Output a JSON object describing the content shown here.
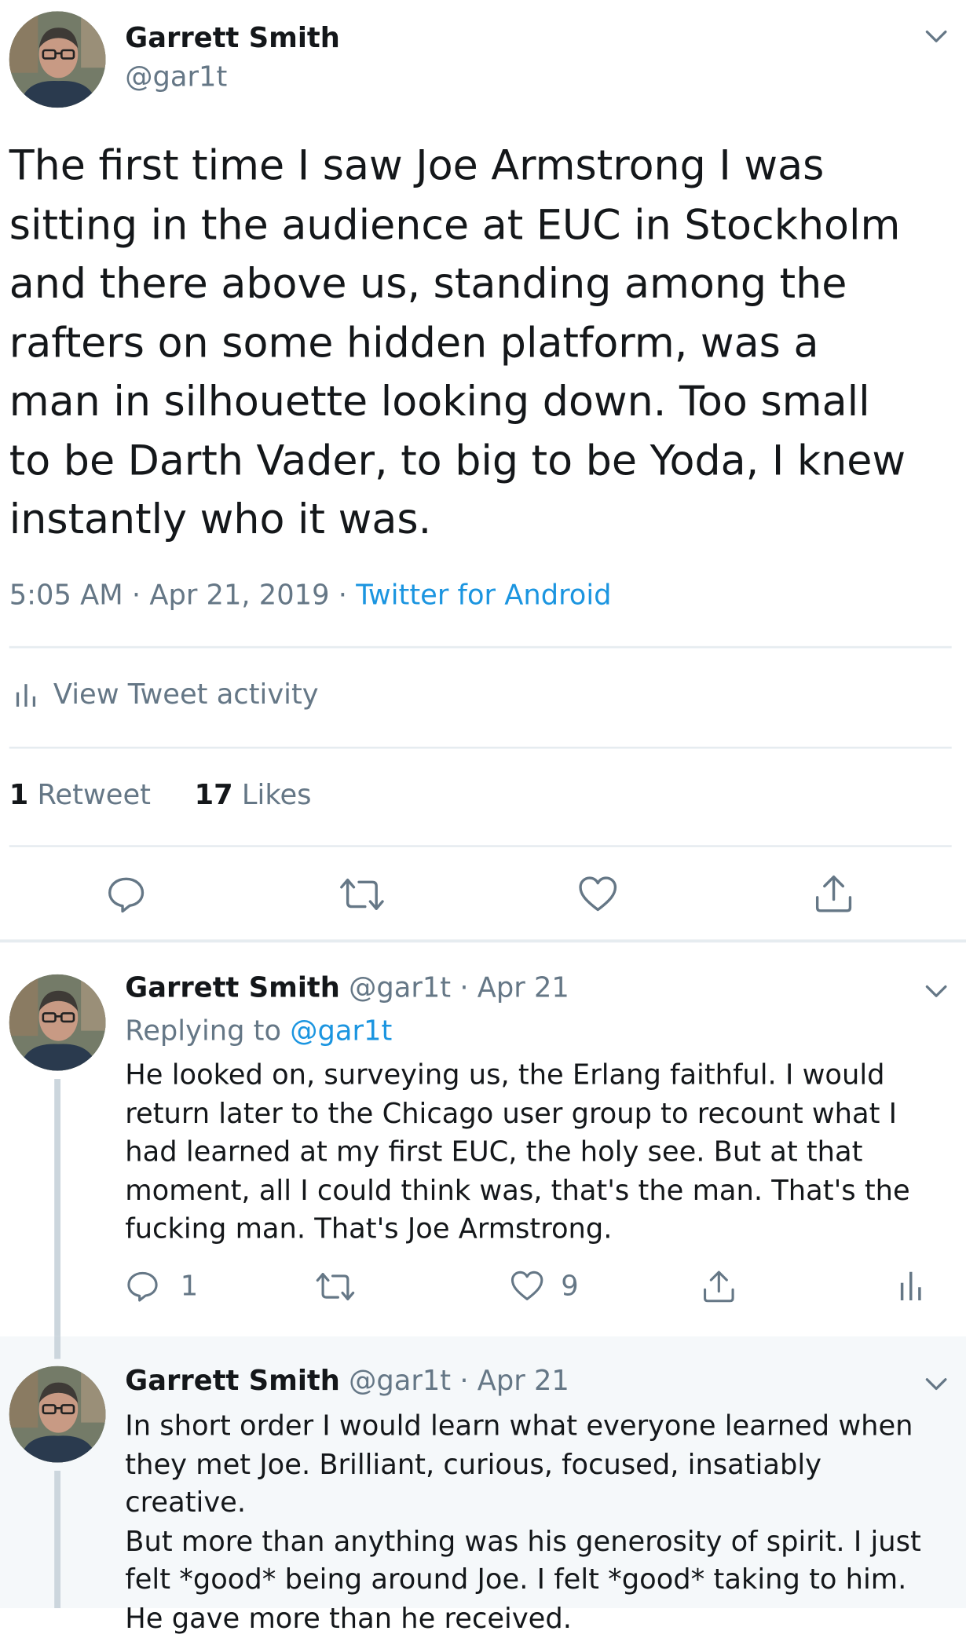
{
  "main_tweet": {
    "author_name": "Garrett Smith",
    "author_handle": "@gar1t",
    "lines": [
      "The first time I saw Joe Armstrong I was",
      "sitting in the audience at EUC in Stockholm",
      "and there above us, standing among the",
      "rafters on some hidden platform, was a",
      "man in silhouette looking down. Too small",
      "to be Darth Vader, to big to be Yoda, I knew",
      "instantly who it was."
    ],
    "time": "5:05 AM",
    "date": "Apr 21, 2019",
    "separator": "·",
    "source": "Twitter for Android",
    "activity_label": "View Tweet activity",
    "retweets_count": "1",
    "retweets_label": "Retweet",
    "likes_count": "17",
    "likes_label": "Likes",
    "actions": [
      "reply-icon",
      "retweet-icon",
      "like-icon",
      "share-icon"
    ]
  },
  "replies": [
    {
      "author_name": "Garrett Smith",
      "author_handle": "@gar1t",
      "separator": "·",
      "date": "Apr 21",
      "replying_prefix": "Replying to",
      "replying_handle": "@gar1t",
      "lines": [
        "He looked on, surveying us, the Erlang faithful. I would",
        "return later to the Chicago user group to recount what I",
        "had learned at my first EUC, the holy see. But at that",
        "moment, all I could think was, that's the man. That's the",
        "fucking man. That's Joe Armstrong."
      ],
      "reply_count": "1",
      "like_count": "9"
    },
    {
      "author_name": "Garrett Smith",
      "author_handle": "@gar1t",
      "separator": "·",
      "date": "Apr 21",
      "lines": [
        "In short order I would learn what everyone learned when",
        "they met Joe. Brilliant, curious, focused, insatiably creative.",
        "But more than anything was his generosity of spirit. I just",
        "felt *good* being around Joe. I felt *good* taking to him.",
        "He gave more than he received."
      ]
    }
  ],
  "colors": {
    "text": "#14171a",
    "secondary": "#657786",
    "link": "#1b95e0",
    "divider": "#e6ecf0",
    "highlight_bg": "#f5f8fa",
    "thread_line": "#ccd6dd"
  }
}
